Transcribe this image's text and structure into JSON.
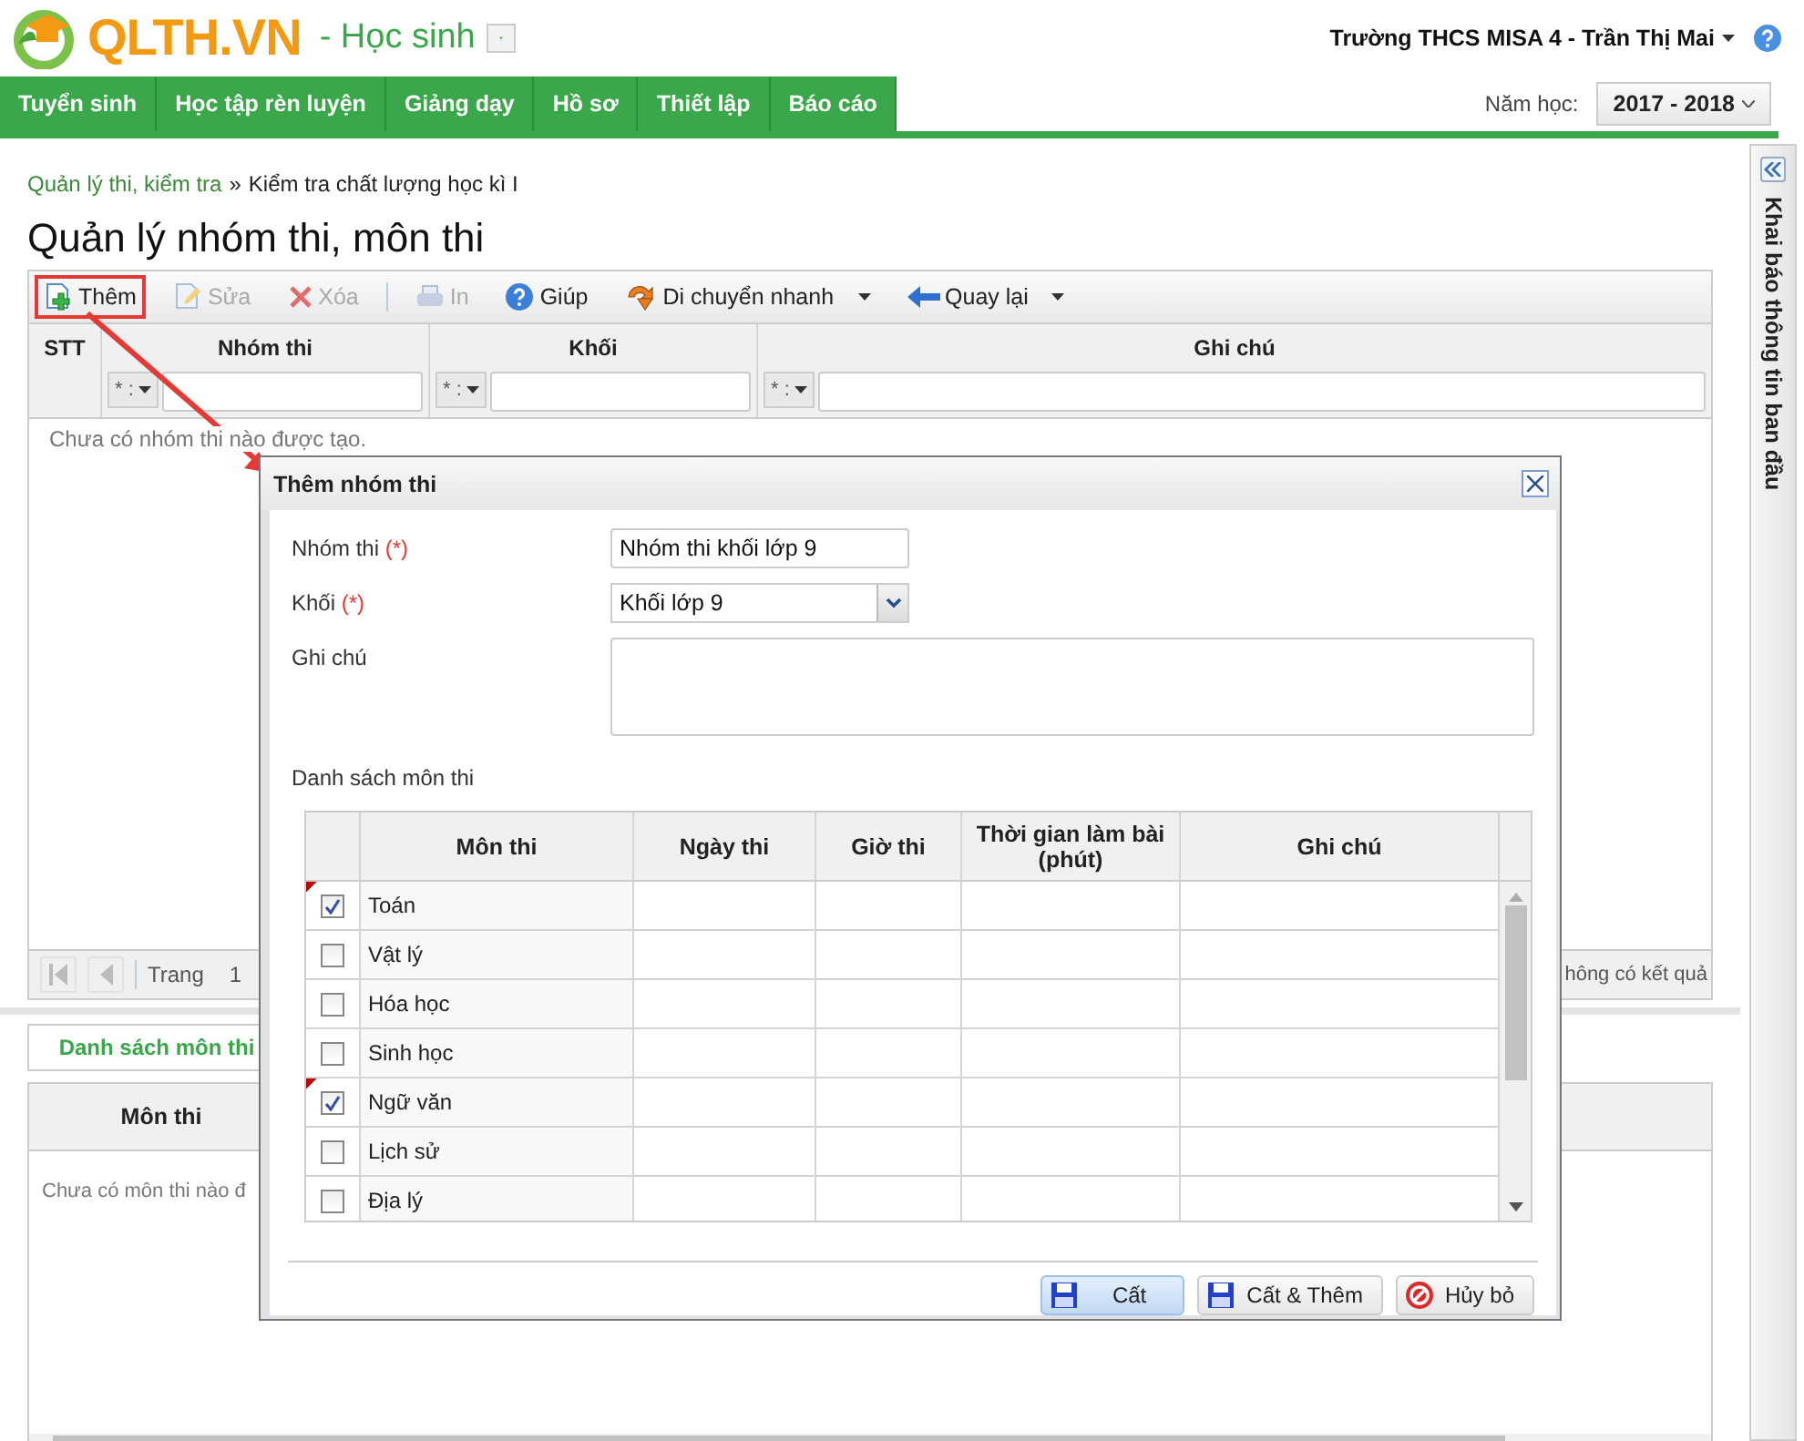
{
  "header": {
    "logo_text": "QLTH.VN",
    "role": "- Học sinh",
    "user": "Trường THCS MISA 4 - Trần Thị Mai"
  },
  "nav": [
    {
      "label": "Tuyển sinh"
    },
    {
      "label": "Học tập rèn luyện"
    },
    {
      "label": "Giảng dạy"
    },
    {
      "label": "Hồ sơ"
    },
    {
      "label": "Thiết lập"
    },
    {
      "label": "Báo cáo"
    }
  ],
  "school_year": {
    "label": "Năm học:",
    "value": "2017 - 2018"
  },
  "breadcrumb": {
    "link": "Quản lý thi, kiểm tra",
    "separator": "»",
    "current": "Kiểm tra chất lượng học kì I"
  },
  "page_title": "Quản lý nhóm thi, môn thi",
  "toolbar": [
    {
      "label": "Thêm",
      "kind": "add",
      "disabled": false,
      "highlighted": true,
      "menu": false
    },
    {
      "label": "Sửa",
      "kind": "edit",
      "disabled": true,
      "highlighted": false,
      "menu": false
    },
    {
      "label": "Xóa",
      "kind": "delete",
      "disabled": true,
      "highlighted": false,
      "menu": false
    },
    {
      "label": "In",
      "kind": "print",
      "disabled": true,
      "highlighted": false,
      "menu": false
    },
    {
      "label": "Giúp",
      "kind": "help",
      "disabled": false,
      "highlighted": false,
      "menu": false
    },
    {
      "label": "Di chuyển nhanh",
      "kind": "move",
      "disabled": false,
      "highlighted": false,
      "menu": true
    },
    {
      "label": "Quay lại",
      "kind": "back",
      "disabled": false,
      "highlighted": false,
      "menu": true
    }
  ],
  "groups_grid": {
    "columns": [
      {
        "label": "STT"
      },
      {
        "label": "Nhóm thi",
        "operator": "* :"
      },
      {
        "label": "Khối",
        "operator": "* :"
      },
      {
        "label": "Ghi chú",
        "operator": "* :"
      }
    ],
    "empty_text": "Chưa có nhóm thi nào được tạo.",
    "pager": {
      "label": "Trang",
      "page": "1",
      "status": "hông có kết quả"
    }
  },
  "subjects_tab": {
    "label": "Danh sách môn thi",
    "selected": true
  },
  "subjects_grid": {
    "columns": [
      {
        "label": "Môn thi"
      }
    ],
    "empty_text": "Chưa có môn thi nào đ"
  },
  "side_panel": {
    "title": "Khai báo thông tin ban đầu"
  },
  "dialog": {
    "title": "Thêm nhóm thi",
    "fields": [
      {
        "label": "Nhóm thi",
        "required_mark": "(*)",
        "kind": "text",
        "value": "Nhóm thi khối lớp 9"
      },
      {
        "label": "Khối",
        "required_mark": "(*)",
        "kind": "select",
        "value": "Khối lớp 9"
      },
      {
        "label": "Ghi chú",
        "kind": "textarea"
      }
    ],
    "list_label": "Danh sách môn thi",
    "columns": [
      "Môn thi",
      "Ngày thi",
      "Giờ thi",
      "Thời gian làm bài (phút)",
      "Ghi chú"
    ],
    "rows": [
      {
        "subject": "Toán",
        "checked": true,
        "modified": true
      },
      {
        "subject": "Vật lý",
        "checked": false,
        "modified": false
      },
      {
        "subject": "Hóa học",
        "checked": false,
        "modified": false
      },
      {
        "subject": "Sinh học",
        "checked": false,
        "modified": false
      },
      {
        "subject": "Ngữ văn",
        "checked": true,
        "modified": true
      },
      {
        "subject": "Lịch sử",
        "checked": false,
        "modified": false
      },
      {
        "subject": "Địa lý",
        "checked": false,
        "modified": false
      }
    ],
    "buttons": [
      {
        "label": "Cất",
        "kind": "save",
        "focused": true
      },
      {
        "label": "Cất & Thêm",
        "kind": "save",
        "focused": false
      },
      {
        "label": "Hủy bỏ",
        "kind": "cancel",
        "focused": false
      }
    ]
  }
}
